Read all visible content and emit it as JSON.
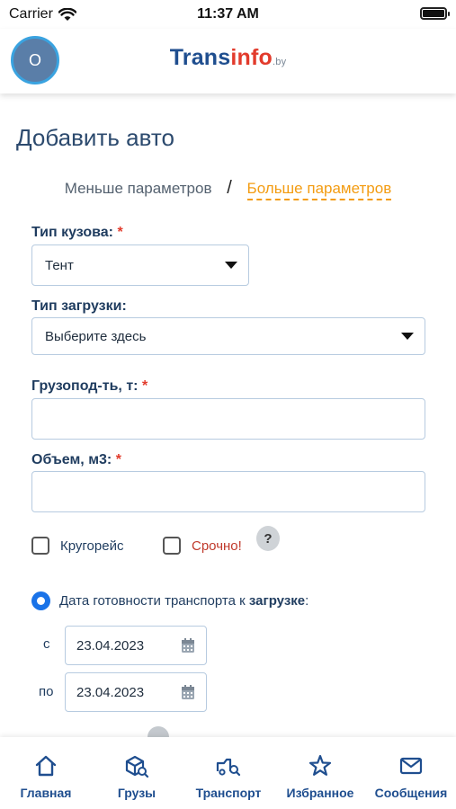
{
  "status": {
    "carrier": "Carrier",
    "time": "11:37 AM"
  },
  "header": {
    "avatar_initial": "O",
    "logo_main": "Trans",
    "logo_accent": "info",
    "logo_domain": ".by"
  },
  "page": {
    "title": "Добавить авто"
  },
  "params": {
    "less_label": "Меньше параметров",
    "separator": "/",
    "more_label": "Больше параметров"
  },
  "form": {
    "body_type": {
      "label": "Тип кузова:",
      "required_mark": "*",
      "value": "Тент"
    },
    "load_type": {
      "label": "Тип загрузки:",
      "value": "Выберите здесь"
    },
    "capacity": {
      "label": "Грузопод-ть, т:",
      "required_mark": "*",
      "value": ""
    },
    "volume": {
      "label": "Объем, м3:",
      "required_mark": "*",
      "value": ""
    },
    "round_trip": {
      "label": "Кругорейс",
      "checked": false
    },
    "urgent": {
      "label": "Срочно!",
      "checked": false
    },
    "help_label": "?",
    "readiness": {
      "label_prefix": "Дата готовности транспорта к ",
      "label_bold": "загрузке",
      "label_suffix": ":",
      "selected": true
    },
    "date_from": {
      "prefix": "с",
      "value": "23.04.2023"
    },
    "date_to": {
      "prefix": "по",
      "value": "23.04.2023"
    }
  },
  "nav": [
    {
      "label": "Главная",
      "icon": "home-icon"
    },
    {
      "label": "Грузы",
      "icon": "cargo-search-icon"
    },
    {
      "label": "Транспорт",
      "icon": "truck-search-icon"
    },
    {
      "label": "Избранное",
      "icon": "star-icon"
    },
    {
      "label": "Сообщения",
      "icon": "mail-icon"
    }
  ],
  "colors": {
    "primary": "#1f4e8f",
    "accent_orange": "#f39c12",
    "required_red": "#e23b2c",
    "radio_blue": "#1a73e8"
  }
}
